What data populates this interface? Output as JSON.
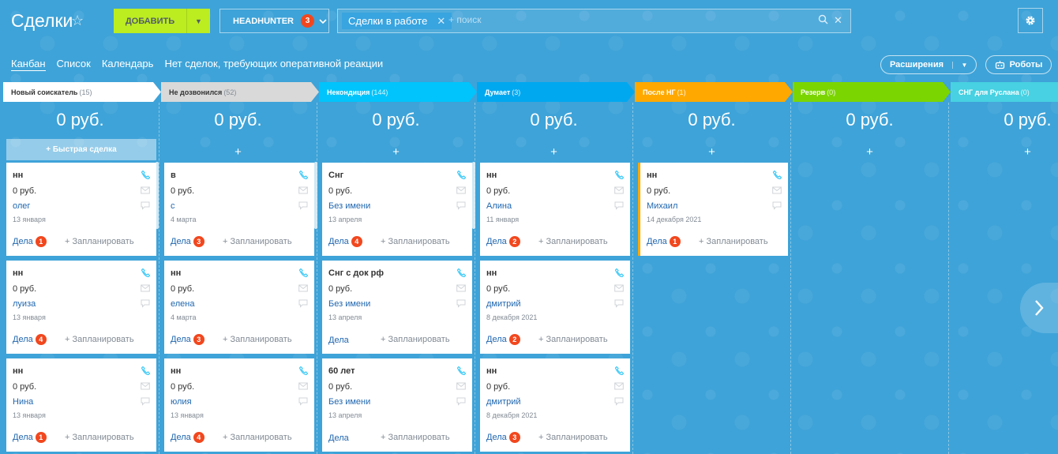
{
  "header": {
    "title": "Сделки",
    "add_label": "ДОБАВИТЬ",
    "category_label": "HEADHUNTER",
    "category_badge": "3",
    "filter_chip": "Сделки в работе",
    "search_placeholder": "+ поиск"
  },
  "views": {
    "kanban": "Канбан",
    "list": "Список",
    "calendar": "Календарь",
    "no_deals": "Нет сделок, требующих оперативной реакции"
  },
  "toolbar": {
    "extensions": "Расширения",
    "robots": "Роботы"
  },
  "common": {
    "quick_deal": "+ Быстрая сделка",
    "plus": "+",
    "deals": "Дела",
    "plan": "+ Запланировать"
  },
  "colors": {
    "col1": "#ffffff",
    "col2": "#d9d9d9",
    "col3": "#00c4fb",
    "col4": "#00a8f0",
    "col5": "#ffa900",
    "col6": "#7bd500",
    "col7": "#47d1e2"
  },
  "columns": [
    {
      "title": "Новый соискатель",
      "count": "(15)",
      "sum": "0 руб.",
      "cards": [
        {
          "name": "нн",
          "price": "0 руб.",
          "contact": "олег",
          "date": "13 января",
          "deals_label": "Дела",
          "badge": "1"
        },
        {
          "name": "нн",
          "price": "0 руб.",
          "contact": "луиза",
          "date": "13 января",
          "deals_label": "Дела",
          "badge": "4"
        },
        {
          "name": "нн",
          "price": "0 руб.",
          "contact": "Нина",
          "date": "13 января",
          "deals_label": "Дела",
          "badge": "1"
        }
      ]
    },
    {
      "title": "Не дозвонился",
      "count": "(52)",
      "sum": "0 руб.",
      "cards": [
        {
          "name": "в",
          "price": "0 руб.",
          "contact": "с",
          "date": "4 марта",
          "deals_label": "Дела",
          "badge": "3"
        },
        {
          "name": "нн",
          "price": "0 руб.",
          "contact": "елена",
          "date": "4 марта",
          "deals_label": "Дела",
          "badge": "3"
        },
        {
          "name": "нн",
          "price": "0 руб.",
          "contact": "юлия",
          "date": "13 января",
          "deals_label": "Дела",
          "badge": "4"
        }
      ]
    },
    {
      "title": "Некондиция",
      "count": "(144)",
      "sum": "0 руб.",
      "cards": [
        {
          "name": "Снг",
          "price": "0 руб.",
          "contact": "Без имени",
          "date": "13 апреля",
          "deals_label": "Дела",
          "badge": "4"
        },
        {
          "name": "Снг с док рф",
          "price": "0 руб.",
          "contact": "Без имени",
          "date": "13 апреля",
          "deals_label": "Дела",
          "badge": ""
        },
        {
          "name": "60 лет",
          "price": "0 руб.",
          "contact": "Без имени",
          "date": "13 апреля",
          "deals_label": "Дела",
          "badge": ""
        }
      ]
    },
    {
      "title": "Думает",
      "count": "(3)",
      "sum": "0 руб.",
      "cards": [
        {
          "name": "нн",
          "price": "0 руб.",
          "contact": "Алина",
          "date": "11 января",
          "deals_label": "Дела",
          "badge": "2"
        },
        {
          "name": "нн",
          "price": "0 руб.",
          "contact": "дмитрий",
          "date": "8 декабря 2021",
          "deals_label": "Дела",
          "badge": "2"
        },
        {
          "name": "нн",
          "price": "0 руб.",
          "contact": "дмитрий",
          "date": "8 декабря 2021",
          "deals_label": "Дела",
          "badge": "3"
        }
      ]
    },
    {
      "title": "После НГ",
      "count": "(1)",
      "sum": "0 руб.",
      "cards": [
        {
          "name": "нн",
          "price": "0 руб.",
          "contact": "Михаил",
          "date": "14 декабря 2021",
          "deals_label": "Дела",
          "badge": "1"
        }
      ]
    },
    {
      "title": "Резерв",
      "count": "(0)",
      "sum": "0 руб.",
      "cards": []
    },
    {
      "title": "СНГ для Руслана",
      "count": "(0)",
      "sum": "0 руб.",
      "cards": []
    }
  ]
}
